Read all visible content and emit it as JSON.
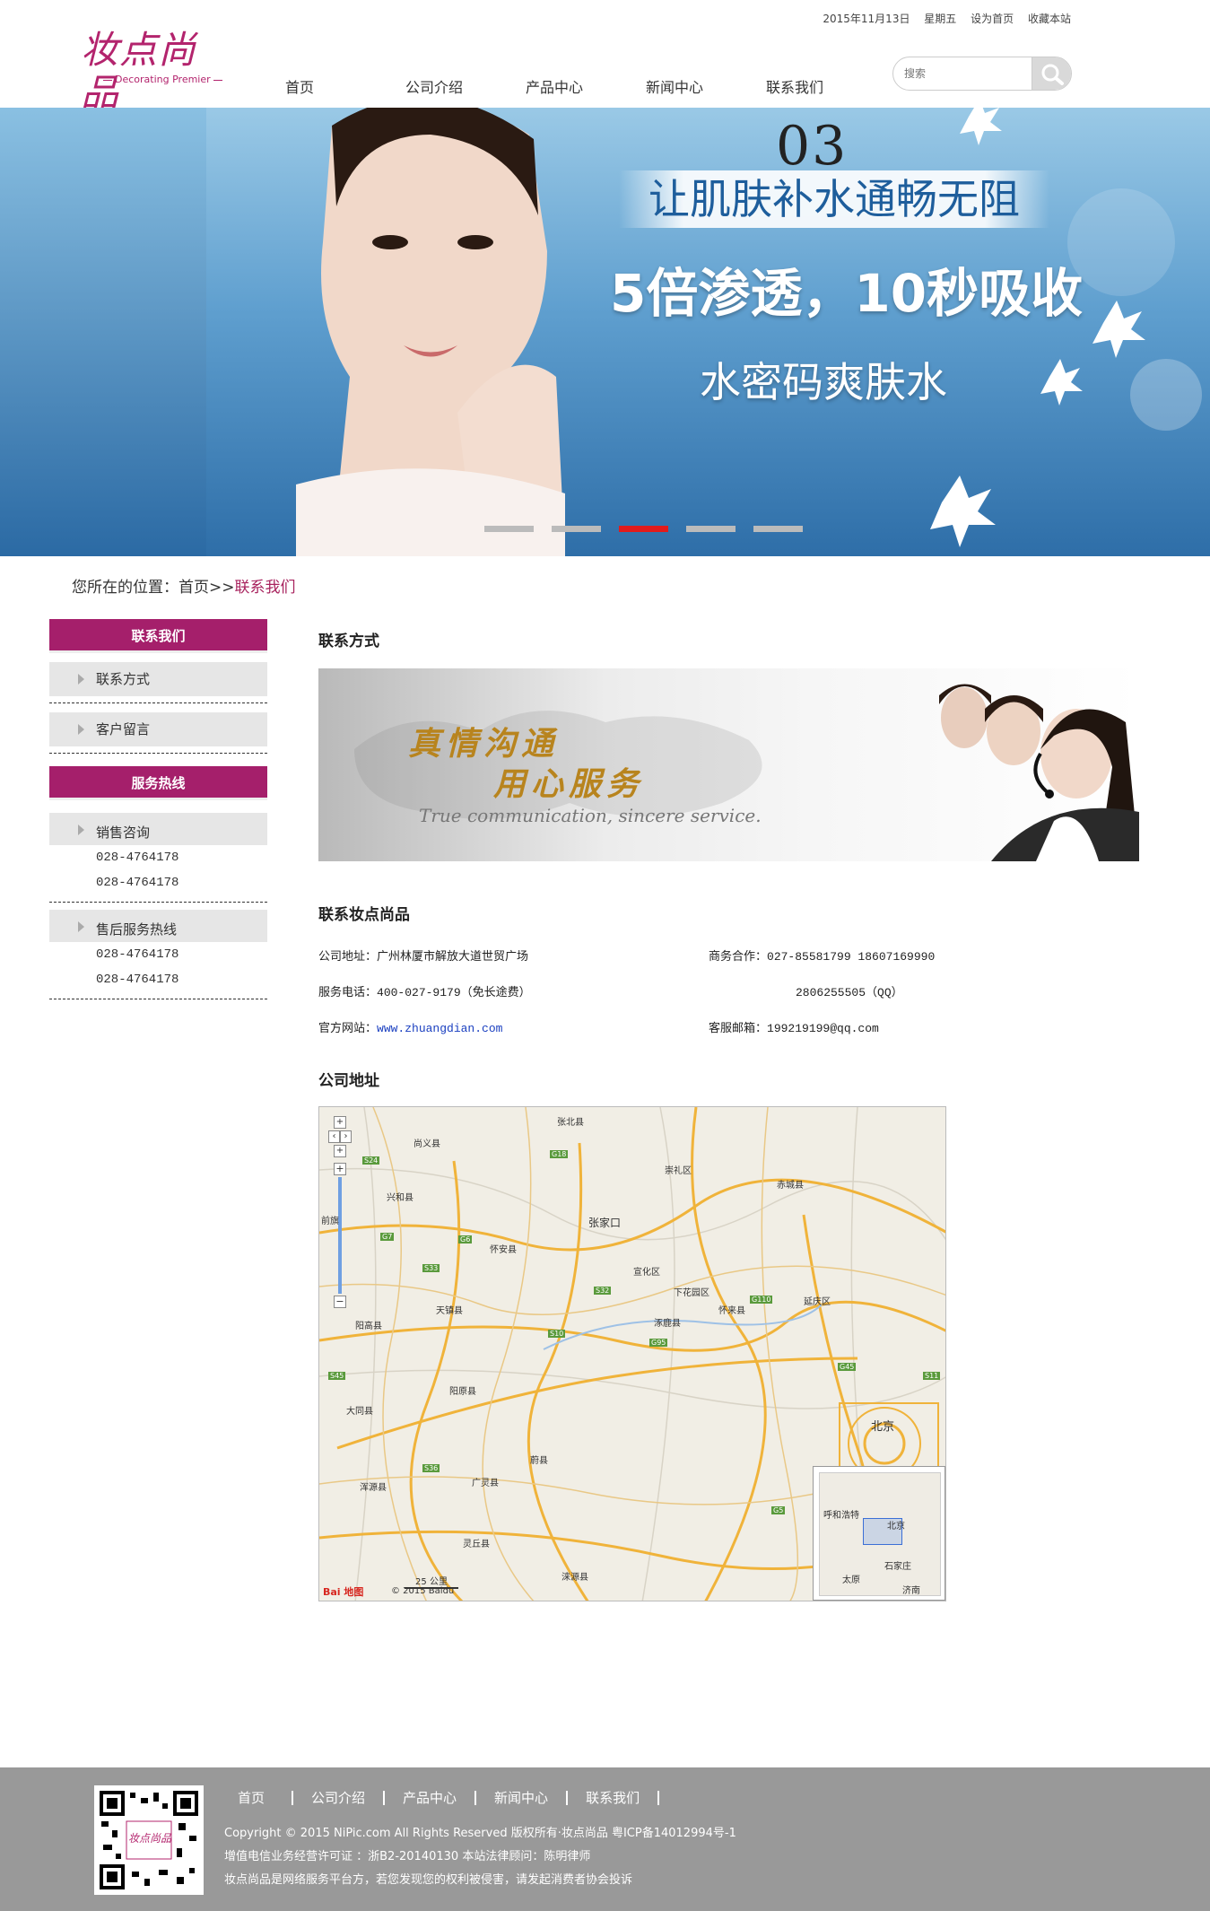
{
  "header": {
    "logo_text": "妆点尚品",
    "logo_sub": "Decorating Premier",
    "date": "2015年11月13日",
    "weekday": "星期五",
    "set_home": "设为首页",
    "bookmark": "收藏本站",
    "nav": [
      "首页",
      "公司介绍",
      "产品中心",
      "新闻中心",
      "联系我们"
    ],
    "search_placeholder": "搜索"
  },
  "banner": {
    "number": "03",
    "headline": "让肌肤补水通畅无阻",
    "subheadline": "5倍渗透，10秒吸收",
    "product": "水密码爽肤水",
    "active_slide": 3,
    "slides": 5
  },
  "breadcrumb": {
    "prefix": "您所在的位置：首页>>",
    "current": "联系我们"
  },
  "sidebar": {
    "contact_header": "联系我们",
    "contact_items": [
      "联系方式",
      "客户留言"
    ],
    "hotline_header": "服务热线",
    "sales_label": "销售咨询",
    "sales_phones": [
      "028-4764178",
      "028-4764178"
    ],
    "aftersales_label": "售后服务热线",
    "aftersales_phones": [
      "028-4764178",
      "028-4764178"
    ]
  },
  "main": {
    "section1_title": "联系方式",
    "banner_line1": "真情沟通",
    "banner_line2": "用心服务",
    "banner_en": "True communication, sincere service.",
    "section2_title": "联系妆点尚品",
    "address_label": "公司地址：",
    "address": "广州林厦市解放大道世贸广场",
    "biz_label": "商务合作：",
    "biz": "027-85581799 18607169990",
    "phone_label": "服务电话：",
    "phone": "400-027-9179（免长途费）",
    "qq": "2806255505（QQ）",
    "site_label": "官方网站：",
    "site": "www.zhuangdian.com",
    "email_label": "客服邮箱：",
    "email": "199219199@qq.com",
    "section3_title": "公司地址"
  },
  "map": {
    "places": [
      "张北县",
      "尚义县",
      "崇礼区",
      "赤城县",
      "兴和县",
      "张家口",
      "怀安县",
      "宣化区",
      "前旗",
      "下花园区",
      "天镇县",
      "怀来县",
      "延庆区",
      "阳高县",
      "涿鹿县",
      "阳原县",
      "大同县",
      "北京",
      "蔚县",
      "浑源县",
      "广灵县",
      "灵丘县",
      "涞源县",
      "呼和浩特",
      "石家庄",
      "太原",
      "济南"
    ],
    "roads": [
      "S24",
      "G7",
      "G6",
      "S33",
      "G18",
      "S32",
      "G110",
      "S10",
      "G95",
      "S45",
      "S36",
      "G5",
      "S11",
      "G45"
    ],
    "scale": "25 公里",
    "copyright": "© 2015 Baidu",
    "brand": "Bai 地图"
  },
  "footer": {
    "nav": [
      "首页",
      "公司介绍",
      "产品中心",
      "新闻中心",
      "联系我们"
    ],
    "copyright": "Copyright © 2015 NiPic.com All Rights Reserved  版权所有·妆点尚品  粤ICP备14012994号-1",
    "license": "增值电信业务经营许可证 ：浙B2-20140130 本站法律顾问：陈明律师",
    "notice": "妆点尚品是网络服务平台方，若您发现您的权利被侵害，请发起消费者协会投诉",
    "qr_logo": "妆点尚品"
  },
  "colors": {
    "brand": "#a51f6b",
    "banner": "#2e6ea8",
    "footer": "#999999",
    "active_dot": "#e21b1b"
  }
}
